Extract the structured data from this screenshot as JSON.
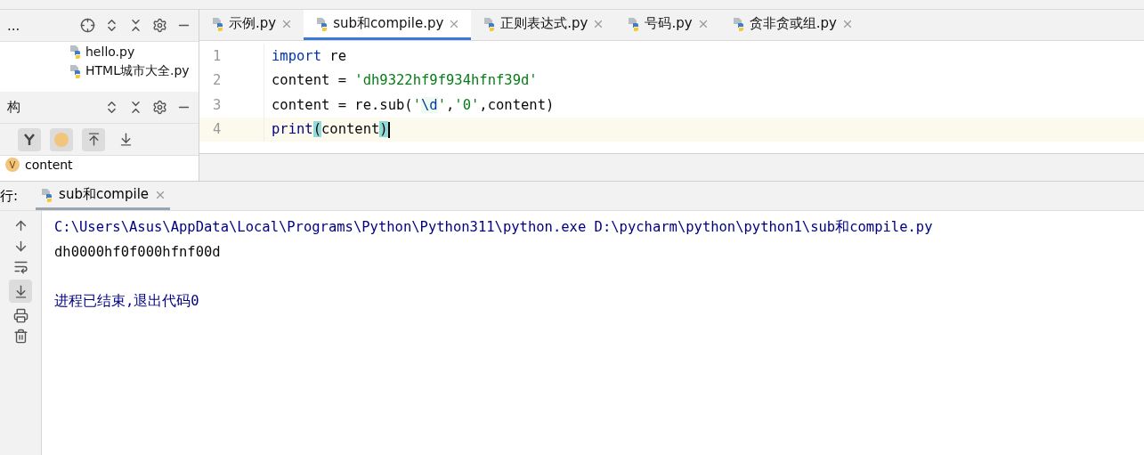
{
  "project_panel": {
    "title": "...",
    "files": [
      {
        "name": "hello.py",
        "selected": false
      },
      {
        "name": "HTML城市大全.py",
        "selected": false
      }
    ]
  },
  "structure_panel": {
    "title": "构",
    "items": [
      {
        "badge": "V",
        "name": "content"
      }
    ]
  },
  "editor_tabs": [
    {
      "label": "示例.py",
      "selected": false
    },
    {
      "label": "sub和compile.py",
      "selected": true
    },
    {
      "label": "正则表达式.py",
      "selected": false
    },
    {
      "label": "号码.py",
      "selected": false
    },
    {
      "label": "贪非贪或组.py",
      "selected": false
    }
  ],
  "editor": {
    "lines": [
      {
        "number": "1",
        "current": false,
        "tokens": [
          {
            "text": "import",
            "kind": "keyword"
          },
          {
            "text": " re",
            "kind": "plain"
          }
        ]
      },
      {
        "number": "2",
        "current": false,
        "tokens": [
          {
            "text": "content = ",
            "kind": "plain"
          },
          {
            "text": "'dh9322hf9f934hfnf39d'",
            "kind": "string"
          }
        ]
      },
      {
        "number": "3",
        "current": false,
        "tokens": [
          {
            "text": "content = re.sub(",
            "kind": "plain"
          },
          {
            "text": "'",
            "kind": "string"
          },
          {
            "text": "\\d",
            "kind": "escape"
          },
          {
            "text": "'",
            "kind": "string"
          },
          {
            "text": ",",
            "kind": "plain"
          },
          {
            "text": "'0'",
            "kind": "string"
          },
          {
            "text": ",content)",
            "kind": "plain"
          }
        ]
      },
      {
        "number": "4",
        "current": true,
        "tokens": [
          {
            "text": "print",
            "kind": "builtin"
          },
          {
            "text": "(",
            "kind": "match"
          },
          {
            "text": "content",
            "kind": "plain"
          },
          {
            "text": ")",
            "kind": "match"
          }
        ]
      }
    ]
  },
  "run_panel": {
    "label": "行:",
    "tab": {
      "label": "sub和compile",
      "selected": true
    },
    "output": [
      {
        "text": "C:\\Users\\Asus\\AppData\\Local\\Programs\\Python\\Python311\\python.exe D:\\pycharm\\python\\python1\\sub和compile.py",
        "kind": "command"
      },
      {
        "text": "dh0000hf0f000hfnf00d",
        "kind": "stdout"
      },
      {
        "text": "进程已结束,退出代码0",
        "kind": "exit"
      }
    ]
  }
}
